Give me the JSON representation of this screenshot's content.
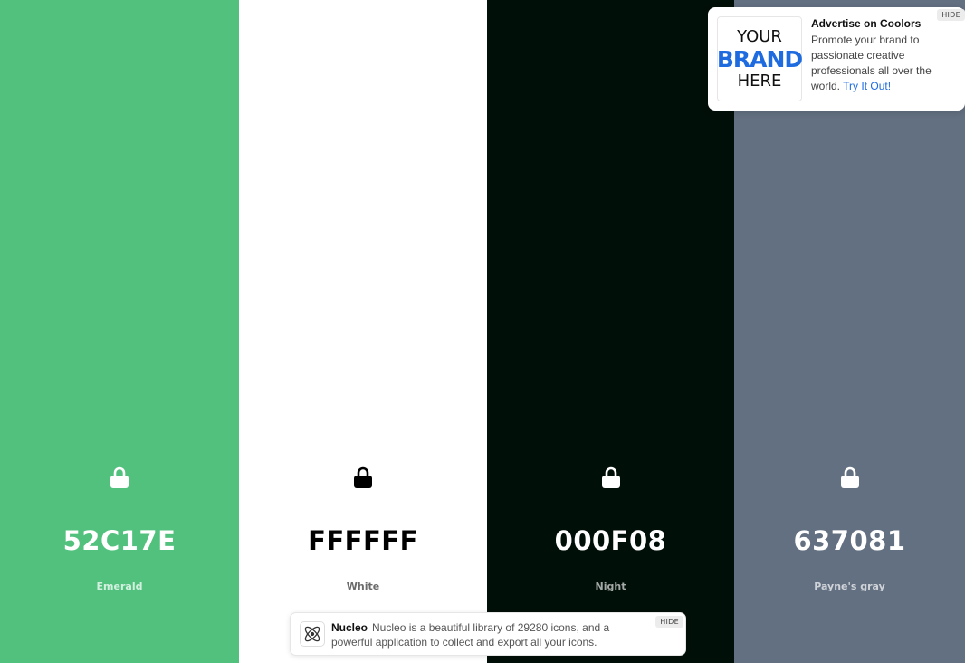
{
  "palette": [
    {
      "hex": "52C17E",
      "name": "Emerald",
      "bg": "#52c17e",
      "text_color": "#ffffff",
      "name_color": "#d3f0df",
      "locked": true
    },
    {
      "hex": "FFFFFF",
      "name": "White",
      "bg": "#ffffff",
      "text_color": "#000000",
      "name_color": "#6b6b6b",
      "locked": true
    },
    {
      "hex": "000F08",
      "name": "Night",
      "bg": "#000f08",
      "text_color": "#ffffff",
      "name_color": "#a5a9a7",
      "locked": true
    },
    {
      "hex": "637081",
      "name": "Payne's gray",
      "bg": "#637081",
      "text_color": "#ffffff",
      "name_color": "#d0d4d9",
      "locked": true
    }
  ],
  "ad_top": {
    "brand_line1": "YOUR",
    "brand_line2": "BRAND",
    "brand_line3": "HERE",
    "title": "Advertise on Coolors",
    "body": "Promote your brand to passionate creative professionals all over the world.",
    "link": "Try It Out!",
    "hide_label": "HIDE"
  },
  "ad_bottom": {
    "icon": "atom-icon",
    "title": "Nucleo",
    "body": "Nucleo is a beautiful library of 29280 icons, and a powerful application to collect and export all your icons.",
    "hide_label": "HIDE"
  }
}
